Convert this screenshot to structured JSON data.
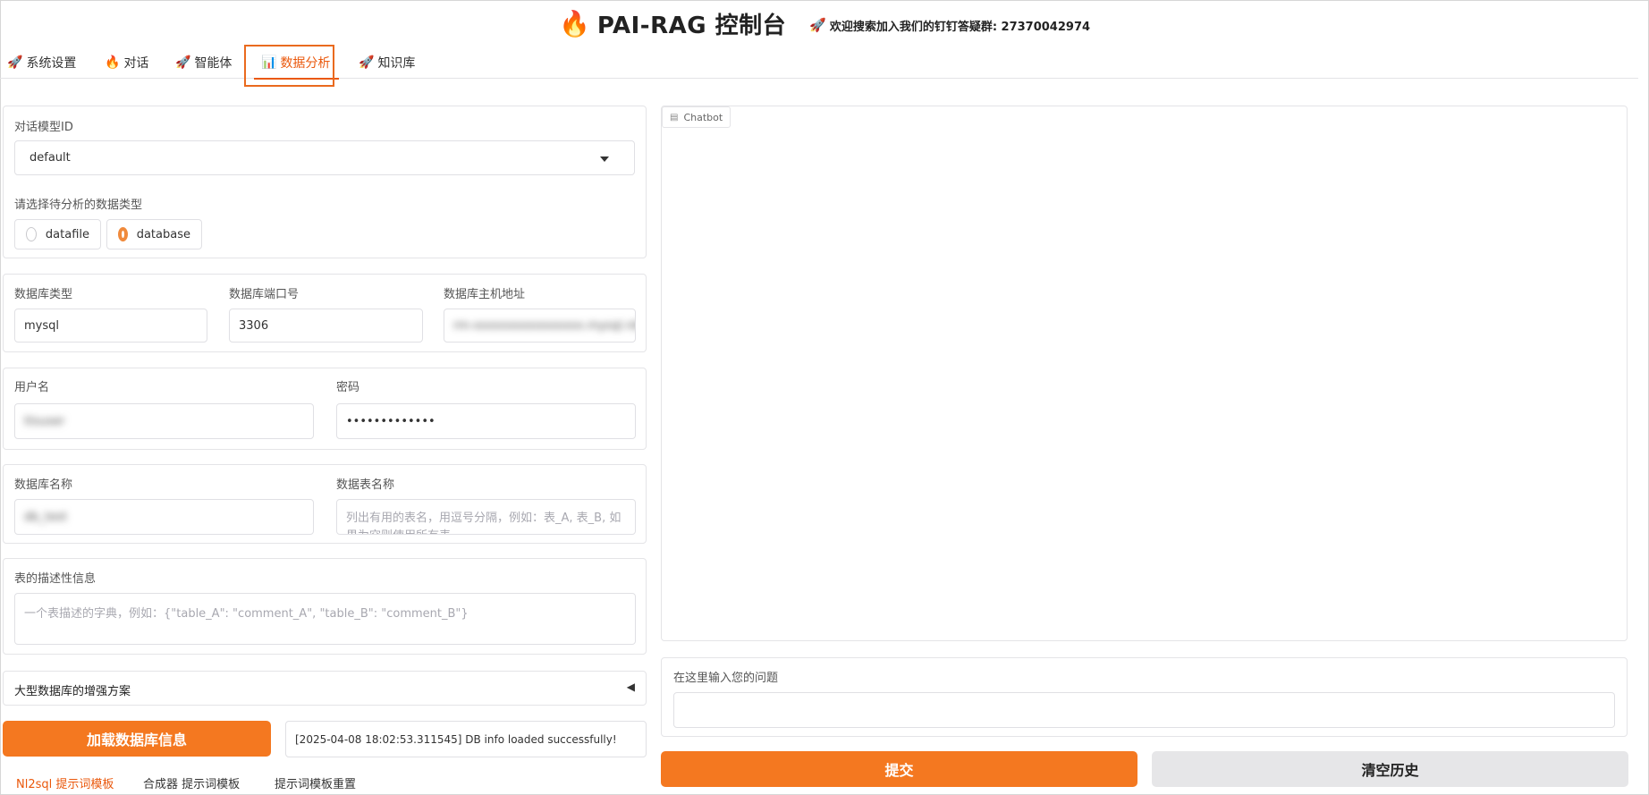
{
  "header": {
    "title": "PAI-RAG 控制台",
    "notice": "欢迎搜索加入我们的钉钉答疑群: 27370042974"
  },
  "tabs": [
    {
      "label": "系统设置"
    },
    {
      "label": "对话"
    },
    {
      "label": "智能体"
    },
    {
      "label": "数据分析"
    },
    {
      "label": "知识库"
    }
  ],
  "form": {
    "model": {
      "label": "对话模型ID",
      "value": "default"
    },
    "data_type": {
      "label": "请选择待分析的数据类型",
      "options": [
        "datafile",
        "database"
      ],
      "selected": "database"
    },
    "db_type": {
      "label": "数据库类型",
      "value": "mysql"
    },
    "db_port": {
      "label": "数据库端口号",
      "value": "3306"
    },
    "db_host": {
      "label": "数据库主机地址",
      "value": "rm-xxxxxxxxxxxxxxxx.mysql.rds"
    },
    "username": {
      "label": "用户名",
      "value": "ttsuser"
    },
    "password": {
      "label": "密码",
      "value": "•••••••••••••"
    },
    "db_name": {
      "label": "数据库名称",
      "value": "db_test"
    },
    "table_name": {
      "label": "数据表名称",
      "placeholder": "列出有用的表名，用逗号分隔，例如：表_A, 表_B, 如果为空则使用所有表"
    },
    "table_desc": {
      "label": "表的描述性信息",
      "placeholder": "一个表描述的字典，例如：{\"table_A\": \"comment_A\", \"table_B\": \"comment_B\"}"
    },
    "accordion": {
      "label": "大型数据库的增强方案"
    }
  },
  "actions": {
    "load_button": "加载数据库信息",
    "status": "[2025-04-08 18:02:53.311545] DB info loaded successfully!"
  },
  "prompt_tabs": [
    "Nl2sql 提示词模板",
    "合成器 提示词模板",
    "提示词模板重置"
  ],
  "chat": {
    "chatbot_label": "Chatbot",
    "question_label": "在这里输入您的问题",
    "submit_button": "提交",
    "clear_button": "清空历史"
  },
  "colors": {
    "accent": "#f47820",
    "active_tab": "#ea580c"
  }
}
